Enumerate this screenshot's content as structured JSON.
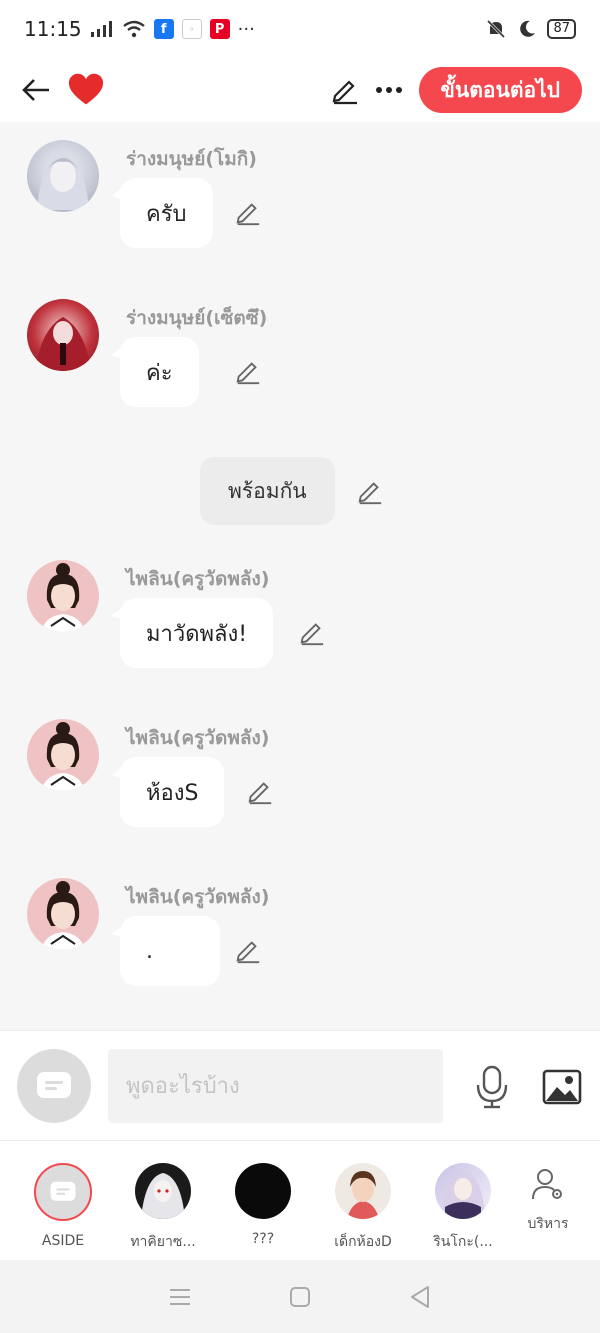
{
  "status_bar": {
    "time": "11:15",
    "more": "···",
    "battery": "87"
  },
  "topbar": {
    "next_label": "ขั้นตอนต่อไป",
    "accent": "#f4474e"
  },
  "messages": [
    {
      "sender": "ร่างมนุษย์(โมกิ)",
      "text": "ครับ"
    },
    {
      "sender": "ร่างมนุษย์(เซ็ตซึ)",
      "text": "ค่ะ"
    },
    {
      "narration": "พร้อมกัน"
    },
    {
      "sender": "ไพลิน(ครูวัดพลัง)",
      "text": "มาวัดพลัง!"
    },
    {
      "sender": "ไพลิน(ครูวัดพลัง)",
      "text": "ห้องS"
    },
    {
      "sender": "ไพลิน(ครูวัดพลัง)",
      "text": "."
    }
  ],
  "input": {
    "placeholder": "พูดอะไรบ้าง"
  },
  "characters": [
    {
      "name": "ASIDE"
    },
    {
      "name": "ทาคิยาซ..."
    },
    {
      "name": "???"
    },
    {
      "name": "เด็กห้องD"
    },
    {
      "name": "รินโกะ(..."
    }
  ],
  "manage_label": "บริหาร",
  "icons": [
    "back-arrow-icon",
    "heart-icon",
    "pencil-icon",
    "more-icon",
    "microphone-icon",
    "image-icon",
    "chat-toggle-icon",
    "manage-user-icon",
    "menu-icon",
    "home-square-icon",
    "back-triangle-icon"
  ]
}
